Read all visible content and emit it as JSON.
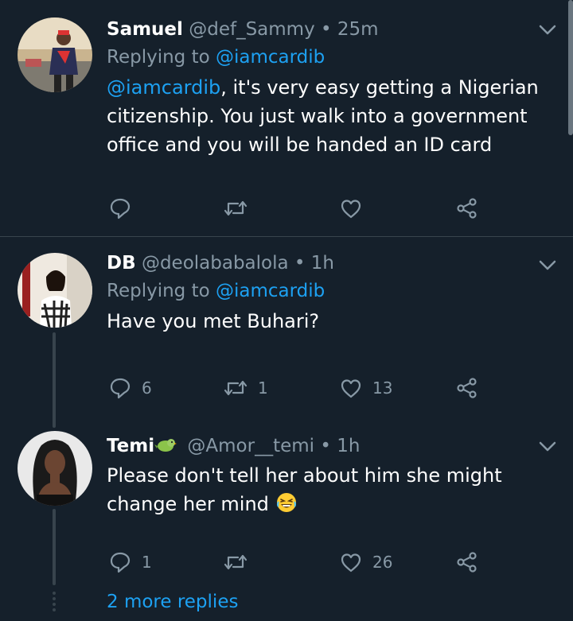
{
  "tweets": [
    {
      "name": "Samuel",
      "handle": "@def_Sammy",
      "separator": "•",
      "time": "25m",
      "replying_prefix": "Replying to",
      "replying_to": "@iamcardib",
      "body_mention": "@iamcardib",
      "body": ", it's very easy getting a Nigerian citizenship. You just walk into a government office and you will be handed an ID card",
      "replies": "",
      "retweets": "",
      "likes": ""
    },
    {
      "name": "DB",
      "handle": "@deolababalola",
      "separator": "•",
      "time": "1h",
      "replying_prefix": "Replying to",
      "replying_to": "@iamcardib",
      "body": "Have you met Buhari?",
      "replies": "6",
      "retweets": "1",
      "likes": "13"
    },
    {
      "name": "Temi",
      "handle": "@Amor__temi",
      "separator": "•",
      "time": "1h",
      "body": "Please don't tell her about him she might change her mind",
      "replies": "1",
      "retweets": "",
      "likes": "26"
    }
  ],
  "more_replies": "2 more replies",
  "icons": {
    "reply": "reply-icon",
    "retweet": "retweet-icon",
    "like": "heart-icon",
    "share": "share-icon",
    "menu": "chevron-down-icon",
    "name_badge": "bird-emoji-icon",
    "body_emoji": "laughing-face-icon"
  },
  "colors": {
    "background": "#15202b",
    "accent": "#1da1f2",
    "secondary_text": "#8899a6",
    "divider": "#38444d"
  }
}
